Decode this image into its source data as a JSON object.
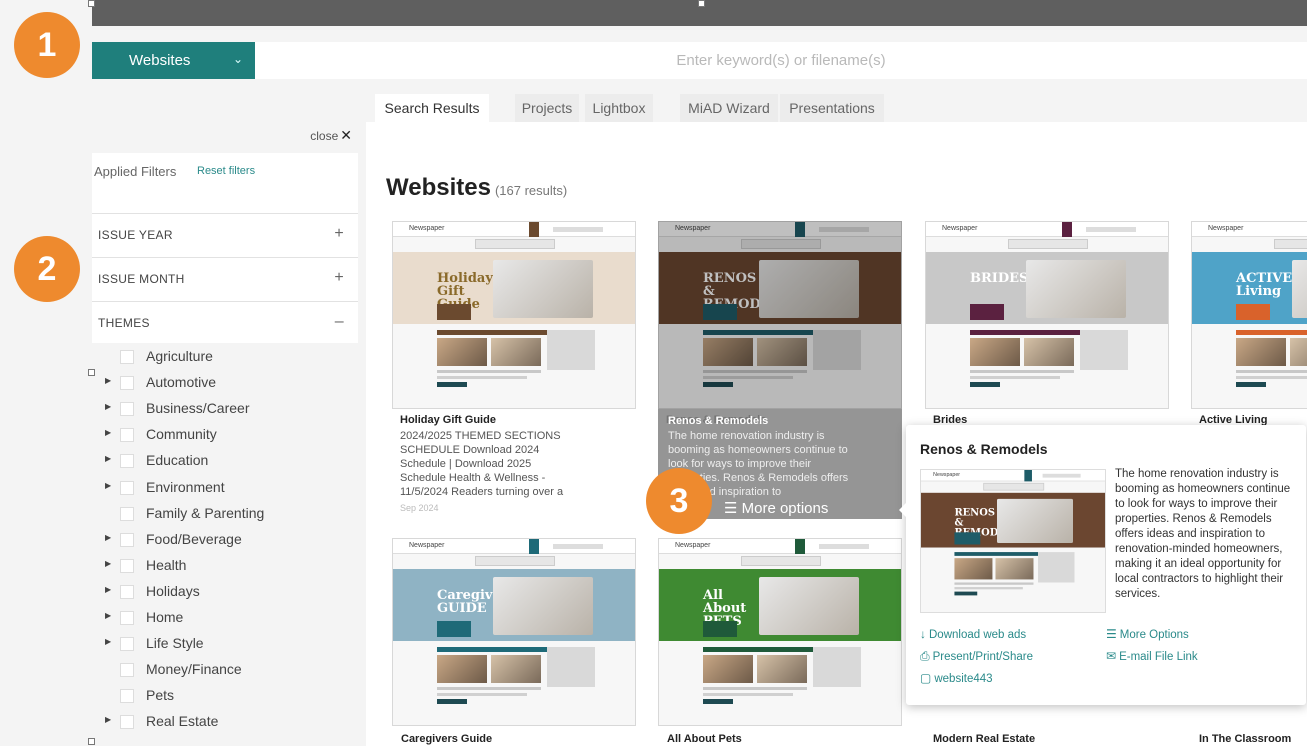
{
  "search": {
    "scope_label": "Websites",
    "placeholder": "Enter keyword(s) or filename(s)"
  },
  "step_badges": [
    "1",
    "2",
    "3"
  ],
  "tabs": [
    {
      "label": "Search Results",
      "active": true
    },
    {
      "label": "Projects",
      "active": false
    },
    {
      "label": "Lightbox",
      "active": false
    },
    {
      "label": "MiAD Wizard",
      "active": false
    },
    {
      "label": "Presentations",
      "active": false
    }
  ],
  "sidebar": {
    "close_label": "close",
    "applied_filters": "Applied Filters",
    "reset_filters": "Reset filters",
    "accordions": [
      {
        "label": "ISSUE YEAR",
        "sign": "+"
      },
      {
        "label": "ISSUE MONTH",
        "sign": "+"
      },
      {
        "label": "THEMES",
        "sign": "–"
      }
    ],
    "themes": [
      {
        "name": "Agriculture",
        "expandable": false
      },
      {
        "name": "Automotive",
        "expandable": true
      },
      {
        "name": "Business/Career",
        "expandable": true
      },
      {
        "name": "Community",
        "expandable": true
      },
      {
        "name": "Education",
        "expandable": true
      },
      {
        "name": "Environment",
        "expandable": true
      },
      {
        "name": "Family & Parenting",
        "expandable": false
      },
      {
        "name": "Food/Beverage",
        "expandable": true
      },
      {
        "name": "Health",
        "expandable": true
      },
      {
        "name": "Holidays",
        "expandable": true
      },
      {
        "name": "Home",
        "expandable": true
      },
      {
        "name": "Life Style",
        "expandable": true
      },
      {
        "name": "Money/Finance",
        "expandable": false
      },
      {
        "name": "Pets",
        "expandable": false
      },
      {
        "name": "Real Estate",
        "expandable": true
      }
    ]
  },
  "results": {
    "heading": "Websites",
    "count": "(167 results)",
    "cards": [
      {
        "title": "Holiday Gift Guide",
        "hero_text": "Holiday Gift Guide",
        "description": "2024/2025 THEMED SECTIONS SCHEDULE Download 2024 Schedule | Download 2025 Schedule Health & Wellness - 11/5/2024 Readers turning over a",
        "date": "Sep 2024",
        "accent": "#6b4a2f",
        "hero_bg": "#e9dccd"
      },
      {
        "title": "Renos & Remodels",
        "hero_text": "RENOS & REMODELS",
        "accent": "#1e5c68",
        "hero_bg": "#6b4630"
      },
      {
        "title": "Brides",
        "hero_text": "BRIDES",
        "accent": "#5b2140",
        "hero_bg": "#c8c8c8"
      },
      {
        "title": "Active Living",
        "hero_text": "ACTIVE Living",
        "accent": "#d9622b",
        "hero_bg": "#4fa3c8"
      },
      {
        "title": "Caregivers Guide",
        "hero_text": "Caregivers GUIDE",
        "accent": "#1e6a78",
        "hero_bg": "#8fb3c4"
      },
      {
        "title": "All About Pets",
        "hero_text": "All About PETS",
        "accent": "#1f5a3a",
        "hero_bg": "#3f8a32"
      },
      {
        "title": "Modern Real Estate"
      },
      {
        "title": "In The Classroom"
      }
    ],
    "hover_overlay": {
      "title": "Renos & Remodels",
      "description": "The home renovation industry is booming as homeowners continue to look for ways to improve their properties. Renos & Remodels offers ideas and inspiration to",
      "more_options": "More options"
    }
  },
  "popover": {
    "title": "Renos & Remodels",
    "description": "The home renovation industry is booming as homeowners continue to look for ways to improve their properties. Renos & Remodels offers ideas and inspiration to renovation-minded homeowners, making it an ideal opportunity for local contractors to highlight their services.",
    "links": {
      "download": "Download web ads",
      "present": "Present/Print/Share",
      "id": "website443",
      "more": "More Options",
      "email": "E-mail File Link"
    }
  },
  "thumb_masthead": "Newspaper",
  "colors": {
    "teal": "#1f7f7c",
    "badge": "#ee8a2e",
    "link": "#2a8a8a"
  },
  "icons": {
    "close": "close-icon",
    "plus": "plus-icon",
    "minus": "minus-icon",
    "expand": "triangle-right-icon",
    "menu": "hamburger-icon",
    "download": "arrow-down-icon",
    "print": "printer-icon",
    "file": "file-icon",
    "email": "envelope-icon",
    "dropdown": "chevron-down-icon"
  }
}
